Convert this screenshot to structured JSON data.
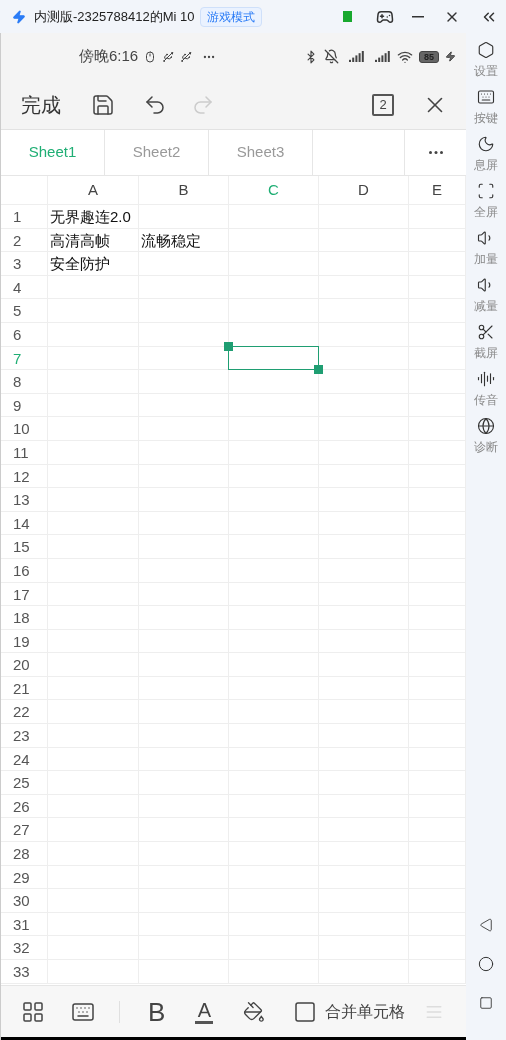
{
  "window": {
    "title": "内测版-2325788412的Mi 10",
    "badge": "游戏模式"
  },
  "status_bar": {
    "time": "傍晚6:16",
    "battery": "85"
  },
  "toolbar": {
    "done": "完成",
    "page_count": "2"
  },
  "sheet_tabs": [
    {
      "label": "Sheet1",
      "selected": true
    },
    {
      "label": "Sheet2",
      "selected": false
    },
    {
      "label": "Sheet3",
      "selected": false
    }
  ],
  "columns": [
    {
      "label": "A",
      "selected": false
    },
    {
      "label": "B",
      "selected": false
    },
    {
      "label": "C",
      "selected": true
    },
    {
      "label": "D",
      "selected": false
    },
    {
      "label": "E",
      "selected": false
    }
  ],
  "rows": [
    {
      "label": "1",
      "selected": false,
      "cells": [
        "无界趣连2.0"
      ]
    },
    {
      "label": "2",
      "selected": false,
      "cells": [
        "高清高帧",
        "流畅稳定"
      ]
    },
    {
      "label": "3",
      "selected": false,
      "cells": [
        "安全防护"
      ]
    },
    {
      "label": "4",
      "selected": false
    },
    {
      "label": "5",
      "selected": false
    },
    {
      "label": "6",
      "selected": false
    },
    {
      "label": "7",
      "selected": true
    },
    {
      "label": "8",
      "selected": false
    },
    {
      "label": "9",
      "selected": false
    },
    {
      "label": "10",
      "selected": false
    },
    {
      "label": "11",
      "selected": false
    },
    {
      "label": "12",
      "selected": false
    },
    {
      "label": "13",
      "selected": false
    },
    {
      "label": "14",
      "selected": false
    },
    {
      "label": "15",
      "selected": false
    },
    {
      "label": "16",
      "selected": false
    },
    {
      "label": "17",
      "selected": false
    },
    {
      "label": "18",
      "selected": false
    },
    {
      "label": "19",
      "selected": false
    },
    {
      "label": "20",
      "selected": false
    },
    {
      "label": "21",
      "selected": false
    },
    {
      "label": "22",
      "selected": false
    },
    {
      "label": "23",
      "selected": false
    },
    {
      "label": "24",
      "selected": false
    },
    {
      "label": "25",
      "selected": false
    },
    {
      "label": "26",
      "selected": false
    },
    {
      "label": "27",
      "selected": false
    },
    {
      "label": "28",
      "selected": false
    },
    {
      "label": "29",
      "selected": false
    },
    {
      "label": "30",
      "selected": false
    },
    {
      "label": "31",
      "selected": false
    },
    {
      "label": "32",
      "selected": false
    },
    {
      "label": "33",
      "selected": false
    }
  ],
  "bottom_toolbar": {
    "bold": "B",
    "font_color": "A",
    "merge": "合并单元格"
  },
  "sidebar": {
    "items": [
      {
        "kind": "settings",
        "label": "设置"
      },
      {
        "kind": "keys",
        "label": "按键"
      },
      {
        "kind": "screen_off",
        "label": "息屏"
      },
      {
        "kind": "fullscreen",
        "label": "全屏"
      },
      {
        "kind": "volume_up",
        "label": "加量"
      },
      {
        "kind": "volume_down",
        "label": "减量"
      },
      {
        "kind": "screenshot",
        "label": "截屏"
      },
      {
        "kind": "audio",
        "label": "传音"
      },
      {
        "kind": "diagnose",
        "label": "诊断"
      }
    ]
  }
}
